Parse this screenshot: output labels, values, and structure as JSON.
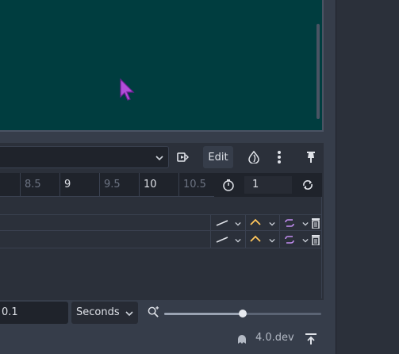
{
  "viewport": {
    "background": "#003d3f"
  },
  "toolbar": {
    "edit_label": "Edit"
  },
  "timeline": {
    "ticks": [
      {
        "label": "8.5",
        "minor": true
      },
      {
        "label": "9",
        "minor": false
      },
      {
        "label": "9.5",
        "minor": true
      },
      {
        "label": "10",
        "minor": false
      },
      {
        "label": "10.5",
        "minor": true
      }
    ],
    "length_value": "1"
  },
  "bottom": {
    "step_value": "0.1",
    "unit_selected": "Seconds",
    "zoom_fraction": 0.5
  },
  "status": {
    "version": "4.0.dev"
  },
  "colors": {
    "interp_accent": "#ffc65c",
    "loop_accent": "#c38ef1",
    "panel": "#2b303a"
  }
}
